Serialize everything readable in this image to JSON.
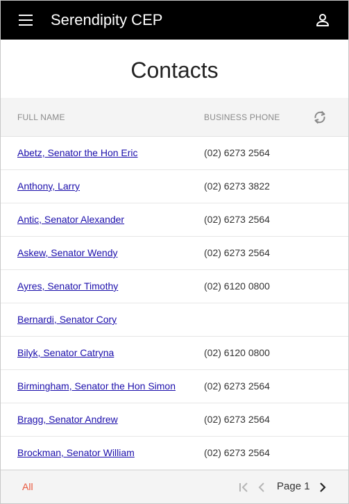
{
  "app": {
    "title": "Serendipity CEP"
  },
  "page": {
    "title": "Contacts"
  },
  "table": {
    "columns": {
      "full_name": "FULL NAME",
      "business_phone": "BUSINESS PHONE"
    },
    "rows": [
      {
        "name": "Abetz, Senator the Hon Eric",
        "phone": "(02) 6273 2564"
      },
      {
        "name": "Anthony, Larry",
        "phone": "(02) 6273 3822"
      },
      {
        "name": "Antic, Senator Alexander",
        "phone": "(02) 6273 2564"
      },
      {
        "name": "Askew, Senator Wendy",
        "phone": "(02) 6273 2564"
      },
      {
        "name": "Ayres, Senator Timothy",
        "phone": "(02) 6120 0800"
      },
      {
        "name": "Bernardi, Senator Cory",
        "phone": ""
      },
      {
        "name": "Bilyk, Senator Catryna",
        "phone": "(02) 6120 0800"
      },
      {
        "name": "Birmingham, Senator the Hon Simon",
        "phone": "(02) 6273 2564"
      },
      {
        "name": "Bragg, Senator Andrew",
        "phone": "(02) 6273 2564"
      },
      {
        "name": "Brockman, Senator William",
        "phone": "(02) 6273 2564"
      }
    ]
  },
  "footer": {
    "filter_label": "All",
    "page_label": "Page 1"
  },
  "icons": {
    "menu": "menu-icon",
    "account": "account-icon",
    "refresh": "refresh-icon",
    "first_page": "first-page-icon",
    "prev_page": "chevron-left-icon",
    "next_page": "chevron-right-icon"
  },
  "colors": {
    "appbar_bg": "#000000",
    "link": "#1a0dab",
    "accent": "#e8553a"
  }
}
